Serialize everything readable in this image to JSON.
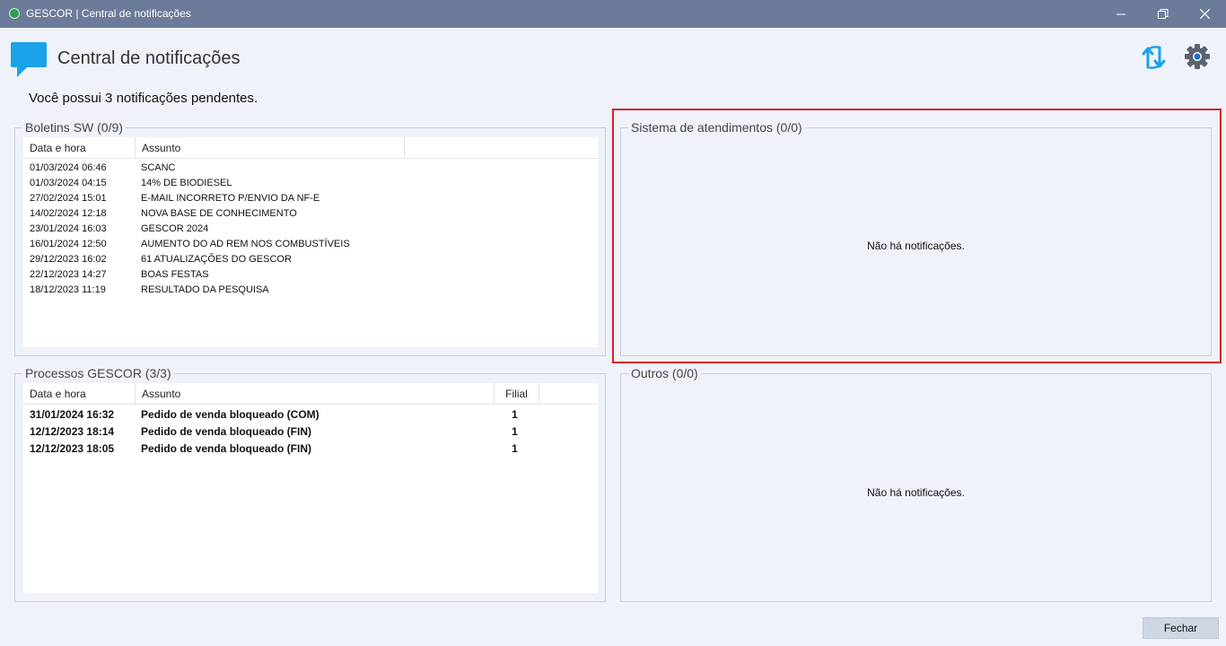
{
  "window": {
    "title": "GESCOR | Central de notificações"
  },
  "header": {
    "title": "Central de notificações"
  },
  "summary": {
    "text": "Você possui 3 notificações pendentes."
  },
  "boletins": {
    "title": "Boletins SW (0/9)",
    "columns": [
      "Data e hora",
      "Assunto"
    ],
    "rows": [
      {
        "datetime": "01/03/2024 06:46",
        "subject": "SCANC"
      },
      {
        "datetime": "01/03/2024 04:15",
        "subject": "14% DE BIODIESEL"
      },
      {
        "datetime": "27/02/2024 15:01",
        "subject": "E-MAIL INCORRETO P/ENVIO DA NF-E"
      },
      {
        "datetime": "14/02/2024 12:18",
        "subject": "NOVA BASE DE CONHECIMENTO"
      },
      {
        "datetime": "23/01/2024 16:03",
        "subject": "GESCOR 2024"
      },
      {
        "datetime": "16/01/2024 12:50",
        "subject": "AUMENTO DO AD REM NOS COMBUSTÍVEIS"
      },
      {
        "datetime": "29/12/2023 16:02",
        "subject": "61 ATUALIZAÇÕES DO GESCOR"
      },
      {
        "datetime": "22/12/2023 14:27",
        "subject": "BOAS FESTAS"
      },
      {
        "datetime": "18/12/2023 11:19",
        "subject": "RESULTADO DA PESQUISA"
      }
    ]
  },
  "processos": {
    "title": "Processos GESCOR (3/3)",
    "columns": [
      "Data e hora",
      "Assunto",
      "Filial"
    ],
    "rows": [
      {
        "datetime": "31/01/2024 16:32",
        "subject": "Pedido de venda bloqueado (COM)",
        "filial": "1"
      },
      {
        "datetime": "12/12/2023 18:14",
        "subject": "Pedido de venda bloqueado (FIN)",
        "filial": "1"
      },
      {
        "datetime": "12/12/2023 18:05",
        "subject": "Pedido de venda bloqueado (FIN)",
        "filial": "1"
      }
    ]
  },
  "atendimentos": {
    "title": "Sistema de atendimentos (0/0)",
    "empty": "Não há notificações."
  },
  "outros": {
    "title": "Outros (0/0)",
    "empty": "Não há notificações."
  },
  "footer": {
    "close_label": "Fechar"
  },
  "icons": {
    "app": "app-logo-icon",
    "minimize": "minimize-icon",
    "restore": "restore-icon",
    "close": "close-icon",
    "header": "chat-bubble-icon",
    "refresh": "refresh-icon",
    "settings": "gear-icon"
  },
  "colors": {
    "titlebar": "#6b7b99",
    "accent": "#1aa3e8",
    "highlight": "#d4202a"
  }
}
